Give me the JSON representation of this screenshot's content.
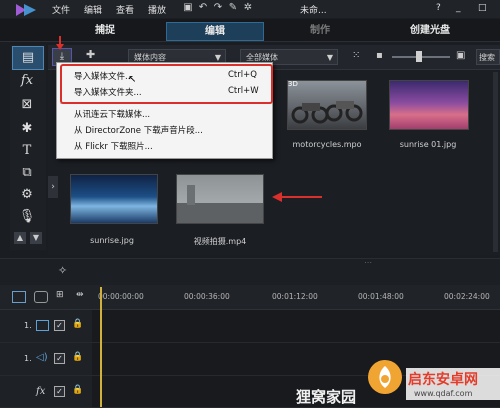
{
  "menubar": {
    "items": [
      "文件",
      "编辑",
      "查看",
      "播放"
    ],
    "project_name": "未命...",
    "help": "?"
  },
  "tabs": [
    {
      "label": "捕捉",
      "state": "normal"
    },
    {
      "label": "编辑",
      "state": "active"
    },
    {
      "label": "制作",
      "state": "disabled"
    },
    {
      "label": "创建光盘",
      "state": "normal"
    }
  ],
  "library_toolbar": {
    "content_filter": "媒体内容",
    "type_filter": "全部媒体",
    "search_label": "搜索"
  },
  "context_menu": {
    "items": [
      {
        "label": "导入媒体文件...",
        "shortcut": "Ctrl+Q"
      },
      {
        "label": "导入媒体文件夹...",
        "shortcut": "Ctrl+W"
      },
      {
        "label": "从讯连云下载媒体...",
        "shortcut": ""
      },
      {
        "label": "从 DirectorZone 下载声音片段...",
        "shortcut": ""
      },
      {
        "label": "从 Flickr 下载照片...",
        "shortcut": ""
      }
    ]
  },
  "media": [
    {
      "name": "motorcycles.mpo",
      "badge": "3D"
    },
    {
      "name": "sunrise 01.jpg",
      "badge": ""
    },
    {
      "name": "sunrise.jpg",
      "badge": ""
    },
    {
      "name": "视频拍摄.mp4",
      "badge": ""
    }
  ],
  "timeline": {
    "timecodes": [
      "00:00:00:00",
      "00:00:36:00",
      "00:01:12:00",
      "00:01:48:00",
      "00:02:24:00"
    ],
    "tracks": [
      {
        "label": "1."
      },
      {
        "label": "1."
      },
      {
        "label": "fx"
      }
    ]
  },
  "watermark": {
    "site_text_1": "狸窝家园",
    "site_text_2": "启东安卓网",
    "site_url": "www.qdaf.com"
  },
  "colors": {
    "accent_blue": "#2d6a94",
    "highlight_red": "#d9302c",
    "playhead": "#d2b03c"
  }
}
